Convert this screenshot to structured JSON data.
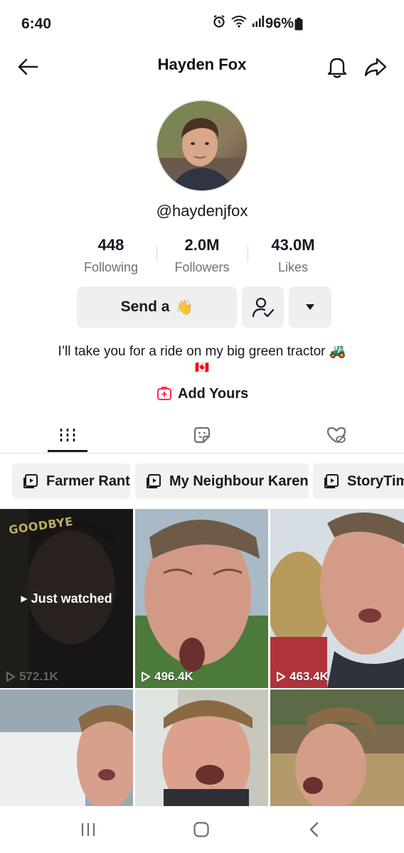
{
  "status_bar": {
    "time": "6:40",
    "battery": "96%"
  },
  "header": {
    "title": "Hayden Fox"
  },
  "profile": {
    "handle": "@haydenjfox",
    "stats": [
      {
        "value": "448",
        "label": "Following"
      },
      {
        "value": "2.0M",
        "label": "Followers"
      },
      {
        "value": "43.0M",
        "label": "Likes"
      }
    ],
    "send_label": "Send a",
    "send_emoji": "👋",
    "bio": "I’ll take you for a ride on my big green tractor 🚜",
    "bio_flag": "🇨🇦",
    "add_yours": "Add Yours"
  },
  "playlists": [
    {
      "label": "Farmer Rant"
    },
    {
      "label": "My Neighbour Karen"
    },
    {
      "label": "StoryTime"
    }
  ],
  "videos": [
    {
      "views": "572.1K",
      "overlay": "Just watched",
      "caption": "GOODBYE"
    },
    {
      "views": "496.4K"
    },
    {
      "views": "463.4K"
    },
    {
      "views": ""
    },
    {
      "views": ""
    },
    {
      "views": ""
    }
  ],
  "colors": {
    "accent_red": "#fe2c55",
    "button_bg": "#efeff0"
  }
}
